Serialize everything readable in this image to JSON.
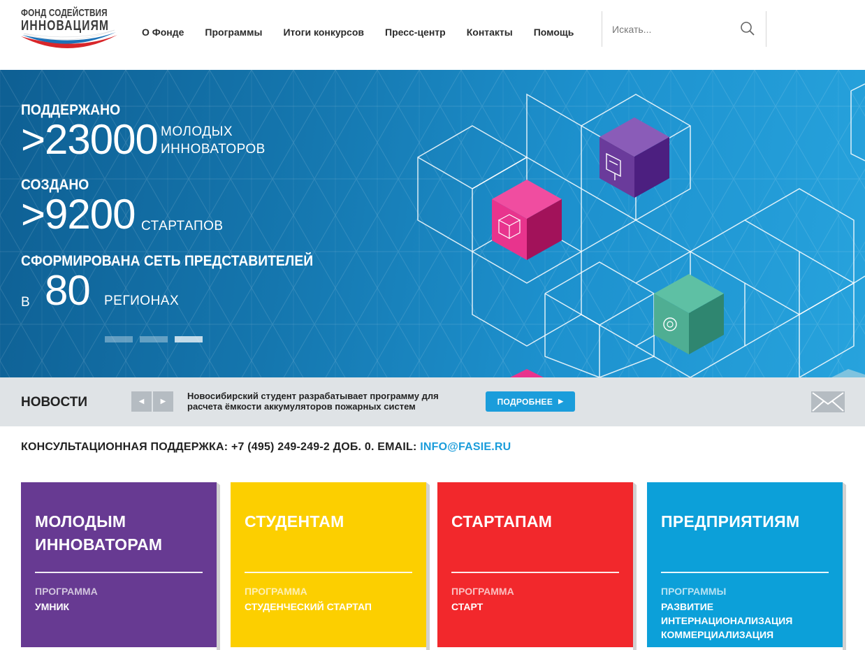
{
  "header": {
    "logo_line1": "ФОНД СОДЕЙСТВИЯ",
    "logo_line2": "ИННОВАЦИЯМ",
    "nav": [
      "О Фонде",
      "Программы",
      "Итоги конкурсов",
      "Пресс-центр",
      "Контакты",
      "Помощь"
    ],
    "search_placeholder": "Искать...",
    "search_icon": "search-icon"
  },
  "hero": {
    "stat1": {
      "label": "ПОДДЕРЖАНО",
      "value": ">23000",
      "unit_line1": "МОЛОДЫХ",
      "unit_line2": "ИННОВАТОРОВ"
    },
    "stat2": {
      "label": "СОЗДАНО",
      "value": ">9200",
      "unit": "СТАРТАПОВ"
    },
    "stat3": {
      "label": "СФОРМИРОВАНА СЕТЬ ПРЕДСТАВИТЕЛЕЙ",
      "prefix": "в",
      "value": "80",
      "unit": "РЕГИОНАХ"
    },
    "slides": 3,
    "active_slide": 3,
    "cube_colors": [
      "#e8348d",
      "#6a3b9b",
      "#4fae93"
    ],
    "cube_icons": [
      "rubik-cube-icon",
      "graduation-cap-icon",
      "gear-icon"
    ]
  },
  "news": {
    "title": "НОВОСТИ",
    "prev_icon": "arrow-left-icon",
    "next_icon": "arrow-right-icon",
    "headline": "Новосибирский студент разрабатывает программу для расчета ёмкости аккумуляторов пожарных систем",
    "more_label": "ПОДРОБНЕЕ",
    "mail_icon": "envelope-icon"
  },
  "consult": {
    "text": "КОНСУЛЬТАЦИОННАЯ ПОДДЕРЖКА: +7 (495) 249-249-2 ДОБ. 0. EMAIL: ",
    "email": "INFO@FASIE.RU"
  },
  "cards": [
    {
      "title": "МОЛОДЫМ ИННОВАТОРАМ",
      "sub": "ПРОГРАММА",
      "items": [
        "УМНИК"
      ],
      "color": "#673a92"
    },
    {
      "title": "СТУДЕНТАМ",
      "sub": "ПРОГРАММА",
      "items": [
        "СТУДЕНЧЕСКИЙ СТАРТАП"
      ],
      "color": "#fccf00"
    },
    {
      "title": "СТАРТАПАМ",
      "sub": "ПРОГРАММА",
      "items": [
        "СТАРТ"
      ],
      "color": "#f2282c"
    },
    {
      "title": "ПРЕДПРИЯТИЯМ",
      "sub": "ПРОГРАММЫ",
      "items": [
        "РАЗВИТИЕ",
        "ИНТЕРНАЦИОНАЛИЗАЦИЯ",
        "КОММЕРЦИАЛИЗАЦИЯ"
      ],
      "color": "#0ca0d9"
    }
  ]
}
